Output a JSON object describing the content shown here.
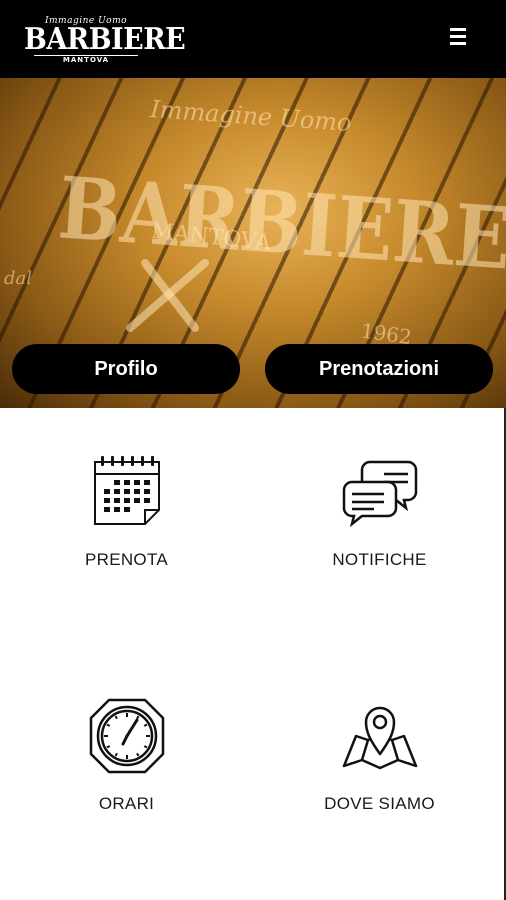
{
  "header": {
    "logo_top": "Immagine Uomo",
    "logo_main": "BARBIERE",
    "logo_sub": "MANTOVA",
    "menu_icon": "hamburger-menu-icon"
  },
  "hero": {
    "watermark_top": "Immagine Uomo",
    "watermark_main": "BARBIERE",
    "watermark_sub": "MANTOVA",
    "watermark_dal": "dal",
    "watermark_year": "1962",
    "profilo_label": "Profilo",
    "prenotazioni_label": "Prenotazioni"
  },
  "menu": [
    {
      "label": "PRENOTA",
      "icon": "calendar-icon"
    },
    {
      "label": "NOTIFICHE",
      "icon": "chat-bubbles-icon"
    },
    {
      "label": "ORARI",
      "icon": "clock-icon"
    },
    {
      "label": "DOVE SIAMO",
      "icon": "map-pin-icon"
    }
  ],
  "colors": {
    "topbar": "#000000",
    "button_bg": "#000000",
    "button_text": "#ffffff",
    "wood": "#c68a2c"
  }
}
